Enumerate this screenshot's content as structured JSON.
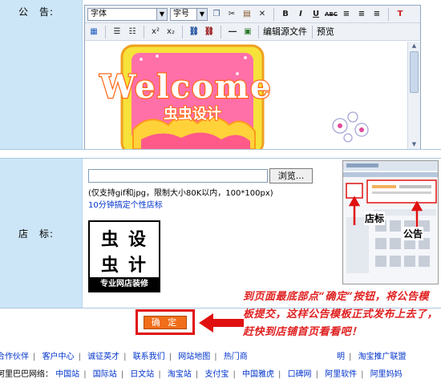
{
  "form": {
    "announcement_label": "公　告:",
    "logo_label": "店　标:"
  },
  "editor": {
    "font_select": "字体",
    "size_select": "字号",
    "toolbar_row1": [
      "B",
      "I",
      "U",
      "ABC"
    ],
    "toolbar_row2": [
      "x²",
      "x₂"
    ],
    "edit_source_link": "编辑源文件",
    "preview_link": "预览",
    "content": {
      "welcome_text": "Welcome",
      "subtitle": "虫虫设计"
    }
  },
  "upload": {
    "browse_button": "浏览...",
    "hint": "(仅支持gif和jpg，限制大小80K以内，100*100px)",
    "help_link": "10分钟搞定个性店标"
  },
  "logo": {
    "char_1": "虫",
    "char_2": "设",
    "char_3": "虫",
    "char_4": "计",
    "banner": "专业网店装修"
  },
  "preview": {
    "callout_logo": "店标",
    "callout_announcement": "公告"
  },
  "annotation": {
    "text": "到页面最底部点“确定”按钮，将公告模板提交，这样公告模板正式发布上去了，赶快到店铺首页看看吧！"
  },
  "confirm_button": "确 定",
  "footer": {
    "row1": [
      "合作伙伴",
      "客户中心",
      "诚征英才",
      "联系我们",
      "网站地图",
      "热门商",
      "明",
      "淘宝推广联盟"
    ],
    "row2_prefix": "阿里巴巴网络：",
    "row2": [
      "中国站",
      "国际站",
      "日文站",
      "淘宝站",
      "支付宝",
      "中国雅虎",
      "口碑网",
      "阿里软件",
      "阿里妈妈"
    ]
  },
  "colors": {
    "label_column": "#cde6f7",
    "annotation_red": "#e02020",
    "confirm_orange": "#f06d1a",
    "link_blue": "#0033cc"
  }
}
